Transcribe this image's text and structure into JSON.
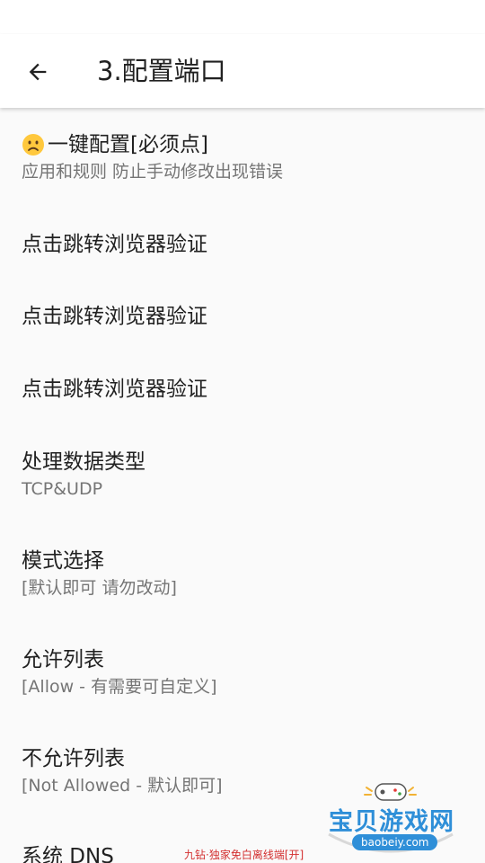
{
  "app_bar": {
    "title": "3.配置端口",
    "back_icon": "arrow-left-icon"
  },
  "preferences": [
    {
      "title": "一键配置[必须点]",
      "summary": "应用和规则 防止手动修改出现错误",
      "icon": "frowning-face-icon"
    },
    {
      "title": "点击跳转浏览器验证",
      "summary": ""
    },
    {
      "title": "点击跳转浏览器验证",
      "summary": ""
    },
    {
      "title": "点击跳转浏览器验证",
      "summary": ""
    },
    {
      "title": "处理数据类型",
      "summary": "TCP&UDP"
    },
    {
      "title": "模式选择",
      "summary": "[默认即可 请勿改动]"
    },
    {
      "title": "允许列表",
      "summary": "[Allow - 有需要可自定义]"
    },
    {
      "title": "不允许列表",
      "summary": "[Not Allowed - 默认即可]"
    },
    {
      "title": "系统 DNS",
      "summary": ""
    }
  ],
  "watermark": {
    "site_name": "宝贝游戏网",
    "domain": "baobeiy.com"
  },
  "promo_text": "九钻·独家免白离线端[开]",
  "colors": {
    "background": "#fafafa",
    "app_bar": "#ffffff",
    "primary_text": "#212121",
    "secondary_text": "#757575",
    "watermark_blue": "#2f8fd8",
    "promo_red": "#d32f2f"
  }
}
